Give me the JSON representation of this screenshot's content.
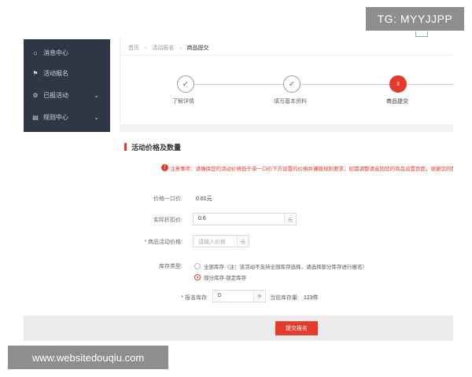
{
  "sidebar": {
    "items": [
      {
        "icon": "home-icon",
        "glyph": "⌂",
        "label": "消息中心",
        "chevron": ""
      },
      {
        "icon": "flag-icon",
        "glyph": "⚑",
        "label": "活动报名",
        "chevron": ""
      },
      {
        "icon": "gear-icon",
        "glyph": "⚙",
        "label": "已报活动",
        "chevron": "⌄"
      },
      {
        "icon": "document-icon",
        "glyph": "▤",
        "label": "规则中心",
        "chevron": "⌄"
      }
    ]
  },
  "breadcrumb": {
    "items": [
      "首页",
      "活动报名",
      "商品提交"
    ],
    "separator": "›"
  },
  "steps": [
    {
      "label": "了解详情",
      "glyph": "✓",
      "state": "done"
    },
    {
      "label": "填写基本资料",
      "glyph": "✓",
      "state": "done"
    },
    {
      "label": "商品提交",
      "glyph": "3",
      "state": "active"
    }
  ],
  "form": {
    "section_title": "活动价格及数量",
    "warning": "注意事项：请确保您的活动价格低于单一口价下方设置的价格并遵循规则要求，如需调整请返回您的商品设置页面，谢谢您的配合",
    "price_label": "价格一口价:",
    "price_value": "0.61元",
    "discount_label": "实际折扣价:",
    "discount_value": "0.6",
    "discount_unit": "元",
    "activity_price_label": "* 商品活动价格:",
    "activity_price_placeholder": "请输入价格",
    "activity_price_unit": "元",
    "stock_type_label": "库存类型:",
    "stock_option_all": "全部库存（注：该活动不支持全部库存选择，请选择部分库存进行报名）",
    "stock_option_partial": "部分库存-锁定库存",
    "stock_label": "* 报名库存:",
    "stock_value": "0",
    "stock_unit": "件",
    "current_stock_label": "当前库存量:",
    "current_stock_value": "123件"
  },
  "submit_label": "提交报名",
  "watermark_top": "TG: MYYJJPP",
  "watermark_bottom": "www.websitedouqiu.com",
  "colors": {
    "accent": "#e43b2d",
    "sidebar_bg": "#2f3646"
  }
}
